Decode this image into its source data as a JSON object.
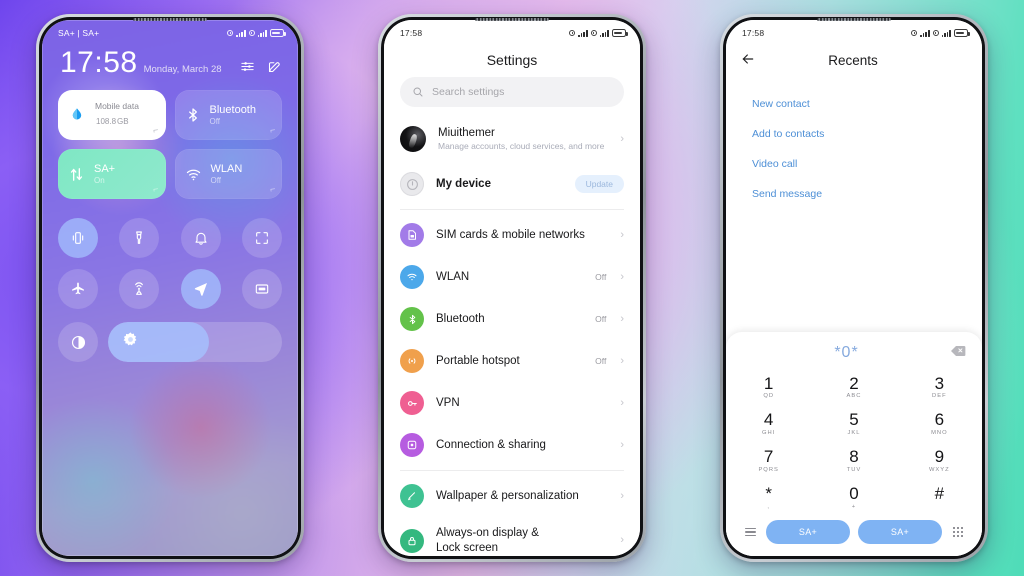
{
  "background": {
    "accent_purple": "#7b52f0",
    "accent_pink": "#e0b6ee",
    "accent_teal": "#4fdcb8"
  },
  "phone1": {
    "name": "control-center",
    "statusbar": {
      "left": "SA+ | SA+",
      "time": ""
    },
    "clock": "17:58",
    "date": "Monday, March 28",
    "header_icons": [
      "sliders-icon",
      "edit-icon"
    ],
    "tiles": [
      {
        "name": "mobile-data",
        "label": "Mobile data",
        "value": "108.8",
        "unit": "GB",
        "icon": "water-drop-icon",
        "style": "white"
      },
      {
        "name": "bluetooth",
        "label": "Bluetooth",
        "sub": "Off",
        "icon": "bluetooth-icon",
        "style": "glass"
      },
      {
        "name": "sa-plus",
        "label": "SA+",
        "sub": "On",
        "icon": "data-transfer-icon",
        "style": "green"
      },
      {
        "name": "wlan",
        "label": "WLAN",
        "sub": "Off",
        "icon": "wifi-icon",
        "style": "glass"
      }
    ],
    "toggles_row1": [
      {
        "name": "vibrate",
        "icon": "vibrate-icon",
        "on": true
      },
      {
        "name": "flashlight",
        "icon": "flashlight-icon",
        "on": false
      },
      {
        "name": "ringtone",
        "icon": "bell-icon",
        "on": false
      },
      {
        "name": "screenshot",
        "icon": "crop-icon",
        "on": false
      }
    ],
    "toggles_row2": [
      {
        "name": "airplane-mode",
        "icon": "airplane-icon",
        "on": false
      },
      {
        "name": "screen-cast",
        "icon": "cast-icon",
        "on": false
      },
      {
        "name": "location",
        "icon": "location-arrow-icon",
        "on": true
      },
      {
        "name": "reading-mode",
        "icon": "window-icon",
        "on": false
      }
    ],
    "bottom": {
      "dark_mode": {
        "name": "dark-mode",
        "icon": "contrast-icon"
      },
      "brightness": {
        "name": "brightness-slider",
        "icon": "brightness-icon",
        "percent": 58
      }
    }
  },
  "phone2": {
    "name": "settings",
    "statusbar": {
      "time": "17:58"
    },
    "title": "Settings",
    "search": {
      "placeholder": "Search settings",
      "icon": "search-icon"
    },
    "account": {
      "name": "Miuithemer",
      "subtitle": "Manage accounts, cloud services, and more",
      "icon": "avatar"
    },
    "device": {
      "name": "My device",
      "badge": "Update",
      "icon": "info-icon"
    },
    "network_items": [
      {
        "label": "SIM cards & mobile networks",
        "value": "",
        "icon": "sim-card-icon",
        "color": "#a27be8"
      },
      {
        "label": "WLAN",
        "value": "Off",
        "icon": "wifi-icon",
        "color": "#4ca8ea"
      },
      {
        "label": "Bluetooth",
        "value": "Off",
        "icon": "bluetooth-icon",
        "color": "#63c24a"
      },
      {
        "label": "Portable hotspot",
        "value": "Off",
        "icon": "hotspot-icon",
        "color": "#f0a04c"
      },
      {
        "label": "VPN",
        "value": "",
        "icon": "vpn-icon",
        "color": "#ef5f92"
      },
      {
        "label": "Connection & sharing",
        "value": "",
        "icon": "share-icon",
        "color": "#b65ce0"
      }
    ],
    "personal_items": [
      {
        "label": "Wallpaper & personalization",
        "value": "",
        "icon": "brush-icon",
        "color": "#3fc292"
      },
      {
        "label": "Always-on display & Lock screen",
        "value": "",
        "icon": "lock-icon",
        "color": "#34b87f"
      }
    ],
    "chevron": "›"
  },
  "phone3": {
    "name": "recents-dialer",
    "statusbar": {
      "time": "17:58"
    },
    "back_icon": "arrow-left-icon",
    "title": "Recents",
    "links": [
      "New contact",
      "Add to contacts",
      "Video call",
      "Send message"
    ],
    "dialer": {
      "number": "*0*",
      "backspace_icon": "backspace-icon",
      "keys": [
        {
          "digit": "1",
          "letters": "QD"
        },
        {
          "digit": "2",
          "letters": "ABC"
        },
        {
          "digit": "3",
          "letters": "DEF"
        },
        {
          "digit": "4",
          "letters": "GHI"
        },
        {
          "digit": "5",
          "letters": "JKL"
        },
        {
          "digit": "6",
          "letters": "MNO"
        },
        {
          "digit": "7",
          "letters": "PQRS"
        },
        {
          "digit": "8",
          "letters": "TUV"
        },
        {
          "digit": "9",
          "letters": "WXYZ"
        },
        {
          "digit": "*",
          "letters": ","
        },
        {
          "digit": "0",
          "letters": "+"
        },
        {
          "digit": "#",
          "letters": ""
        }
      ],
      "menu_icon": "hamburger-icon",
      "call_sim1": "SA+",
      "call_sim2": "SA+",
      "keypad_icon": "keypad-icon",
      "call_button_color": "#7fb3f3"
    }
  }
}
